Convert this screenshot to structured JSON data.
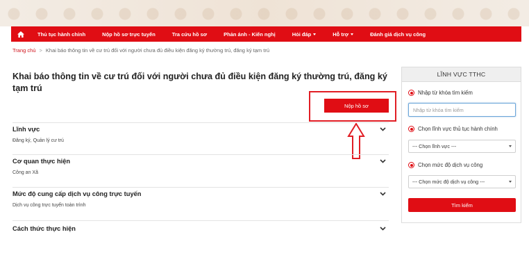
{
  "nav": {
    "home_icon": "home-icon",
    "items": [
      {
        "label": "Thủ tục hành chính",
        "dropdown": false
      },
      {
        "label": "Nộp hồ sơ trực tuyến",
        "dropdown": false
      },
      {
        "label": "Tra cứu hồ sơ",
        "dropdown": false
      },
      {
        "label": "Phản ánh - Kiến nghị",
        "dropdown": false
      },
      {
        "label": "Hỏi đáp",
        "dropdown": true
      },
      {
        "label": "Hỗ trợ",
        "dropdown": true
      },
      {
        "label": "Đánh giá dịch vụ công",
        "dropdown": false
      }
    ]
  },
  "breadcrumb": {
    "home": "Trang chủ",
    "separator": ">",
    "current": "Khai báo thông tin về cư trú đối với người chưa đủ điều kiện đăng ký thường trú, đăng ký tạm trú"
  },
  "page_title": "Khai báo thông tin về cư trú đối với người chưa đủ điều kiện đăng ký thường trú, đăng ký tạm trú",
  "submit_button": "Nộp hồ sơ",
  "sections": [
    {
      "title": "Lĩnh vực",
      "value": "Đăng ký, Quản lý cư trú"
    },
    {
      "title": "Cơ quan thực hiện",
      "value": "Công an Xã"
    },
    {
      "title": "Mức độ cung cấp dịch vụ công trực tuyến",
      "value": "Dịch vụ công trực tuyến toàn trình"
    },
    {
      "title": "Cách thức thực hiện",
      "value": ""
    }
  ],
  "panel": {
    "title": "LĨNH VỰC TTHC",
    "keyword_label": "Nhập từ khóa tìm kiếm",
    "keyword_placeholder": "Nhập từ khóa tìm kiếm",
    "field_label": "Chọn lĩnh vực thủ tục hành chính",
    "field_selected": "--- Chọn lĩnh vực ---",
    "level_label": "Chọn mức độ dịch vụ công",
    "level_selected": "--- Chọn mức độ dịch vụ công ---",
    "search_button": "Tìm kiếm"
  },
  "colors": {
    "brand_red": "#e00d14",
    "annotation_red": "#e11d24"
  }
}
